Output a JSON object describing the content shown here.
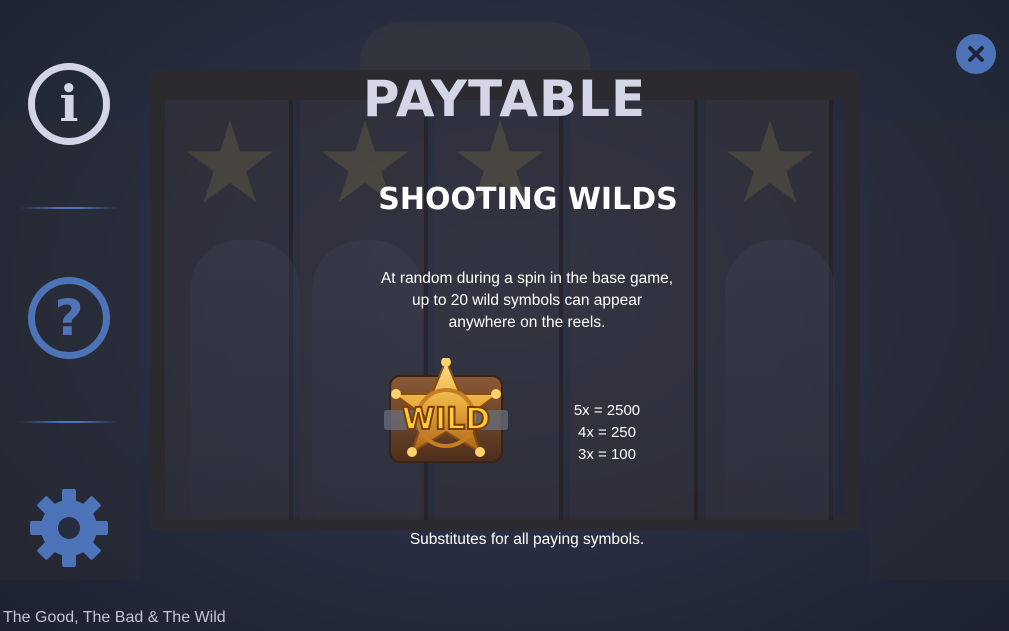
{
  "header": {
    "title": "PAYTABLE"
  },
  "sidebar": {
    "items": [
      {
        "icon": "info-icon",
        "glyph": "i",
        "color": "#d3d5e6",
        "active": true
      },
      {
        "icon": "help-icon",
        "glyph": "?",
        "color": "#4d73b8",
        "active": false
      },
      {
        "icon": "gear-icon",
        "color": "#4d73b8",
        "active": false
      }
    ]
  },
  "close_button": {
    "icon": "close-icon",
    "glyph": "✕"
  },
  "section": {
    "title": "SHOOTING WILDS",
    "description": [
      "At random during a spin in the base game,",
      "up to 20 wild symbols can appear",
      "anywhere on the reels."
    ],
    "symbol": {
      "label": "WILD",
      "icon": "sheriff-star-wild-icon"
    },
    "payouts": [
      "5x = 2500",
      "4x = 250",
      "3x = 100"
    ],
    "note": "Substitutes for all paying symbols."
  },
  "footer": {
    "game_name": "The Good, The Bad & The Wild"
  },
  "colors": {
    "accent": "#4d73b8",
    "title": "#d4d6e8",
    "text": "#ffffff"
  }
}
